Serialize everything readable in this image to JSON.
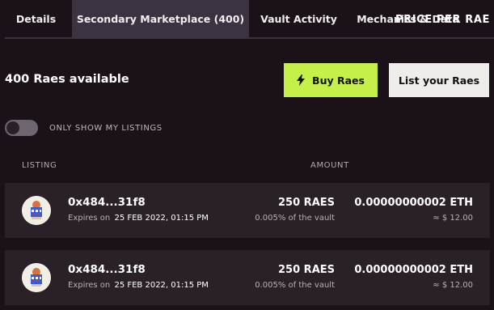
{
  "tabs": [
    {
      "label": "Details",
      "active": false
    },
    {
      "label": "Secondary Marketplace (400)",
      "active": true
    },
    {
      "label": "Vault Activity",
      "active": false
    },
    {
      "label": "Mechanics & Data",
      "active": false
    }
  ],
  "marketplace": {
    "available_title": "400 Raes available",
    "buy_button": "Buy Raes",
    "list_button": "List your Raes",
    "toggle_label": "ONLY SHOW MY LISTINGS",
    "toggle_on": false
  },
  "table": {
    "headers": {
      "listing": "LISTING",
      "amount": "AMOUNT",
      "price": "PRICE PER RAE"
    },
    "sort": "descending",
    "rows": [
      {
        "address": "0x484...31f8",
        "expires_prefix": "Expires on",
        "expires_date": "25 FEB 2022, 01:15 PM",
        "amount": "250 RAES",
        "vault_pct": "0.005% of the vault",
        "price_eth": "0.00000000002 ETH",
        "price_usd": "≈ $ 12.00"
      },
      {
        "address": "0x484...31f8",
        "expires_prefix": "Expires on",
        "expires_date": "25 FEB 2022, 01:15 PM",
        "amount": "250 RAES",
        "vault_pct": "0.005% of the vault",
        "price_eth": "0.00000000002 ETH",
        "price_usd": "≈ $ 12.00"
      }
    ]
  },
  "colors": {
    "background": "#1b1219",
    "active_tab": "#3b3340",
    "buy_accent": "#c5f04a",
    "row_bg": "#292028"
  },
  "icons": {
    "buy": "lightning-bolt-icon",
    "sort": "arrow-down-icon",
    "avatar": "nft-avatar-icon"
  }
}
